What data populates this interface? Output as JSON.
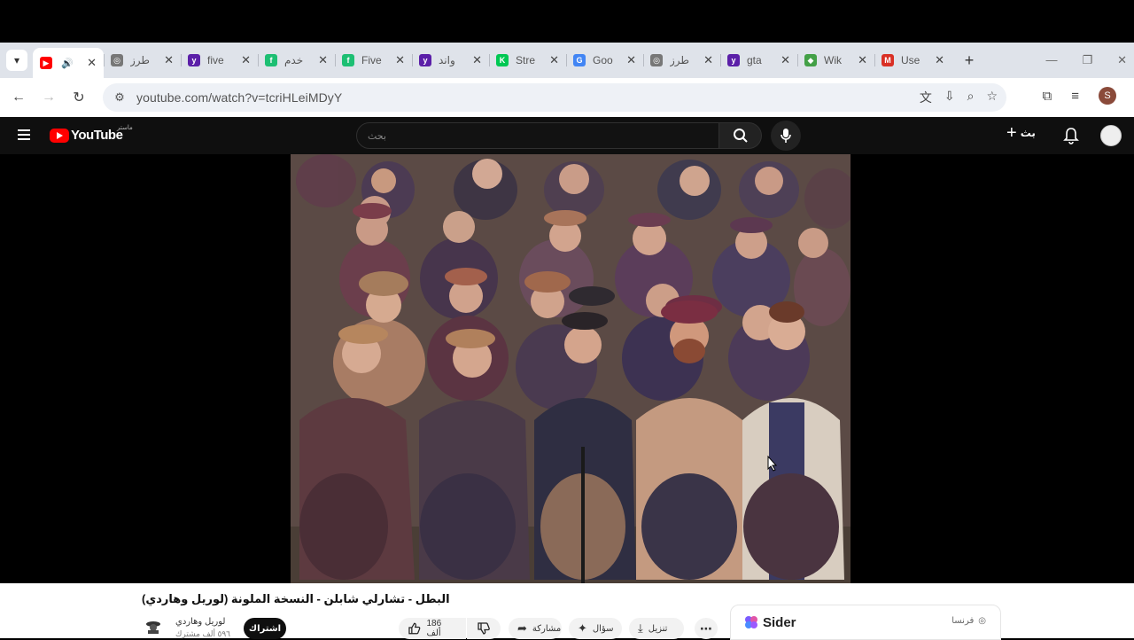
{
  "browser": {
    "tabs": [
      {
        "label": "",
        "favicon_color": "#ff0000",
        "favicon_glyph": "▶",
        "active": true,
        "audio": true
      },
      {
        "label": "طرز",
        "favicon_color": "#777777",
        "favicon_glyph": "◎"
      },
      {
        "label": "five",
        "favicon_color": "#5b1fa8",
        "favicon_glyph": "y"
      },
      {
        "label": "خدم",
        "favicon_color": "#1dbf73",
        "favicon_glyph": "f"
      },
      {
        "label": "Five",
        "favicon_color": "#1dbf73",
        "favicon_glyph": "f"
      },
      {
        "label": "واند",
        "favicon_color": "#5b1fa8",
        "favicon_glyph": "y"
      },
      {
        "label": "Stre",
        "favicon_color": "#00c853",
        "favicon_glyph": "K"
      },
      {
        "label": "Goo",
        "favicon_color": "#4285f4",
        "favicon_glyph": "G"
      },
      {
        "label": "طرز",
        "favicon_color": "#777777",
        "favicon_glyph": "◎"
      },
      {
        "label": "gta",
        "favicon_color": "#5b1fa8",
        "favicon_glyph": "y"
      },
      {
        "label": "Wik",
        "favicon_color": "#43a047",
        "favicon_glyph": "◆"
      },
      {
        "label": "Use",
        "favicon_color": "#d93025",
        "favicon_glyph": "M"
      }
    ],
    "url": "youtube.com/watch?v=tcriHLeiMDyY",
    "profile_initial": "S"
  },
  "youtube": {
    "logo_text": "YouTube",
    "country_code": "ماستر",
    "search_placeholder": "بحث",
    "create_label": "بث",
    "video": {
      "title": "البطل - تشارلي شابلن - النسخة الملونة (لوريل وهاردي)",
      "channel_name": "لوريل وهاردي",
      "channel_subs": "٥٩٦ ألف مشترك",
      "subscribe_label": "اشتراك",
      "likes": "186 ألف",
      "share_label": "مشاركة",
      "ask_label": "سؤال",
      "download_label": "تنزيل"
    }
  },
  "sider": {
    "name": "Sider",
    "language": "فرنسا"
  }
}
